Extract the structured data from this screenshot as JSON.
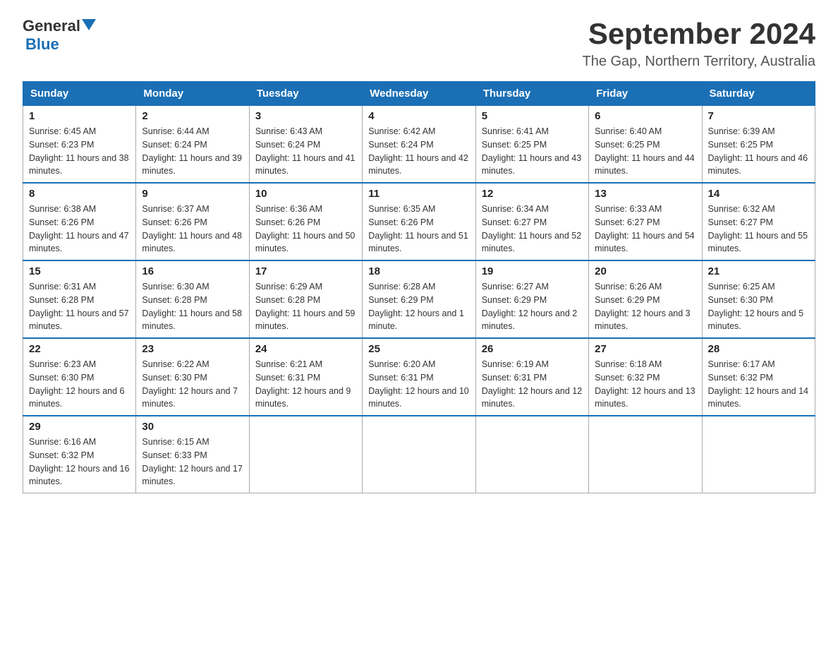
{
  "header": {
    "logo_text_general": "General",
    "logo_text_blue": "Blue",
    "month_year": "September 2024",
    "location": "The Gap, Northern Territory, Australia"
  },
  "days_of_week": [
    "Sunday",
    "Monday",
    "Tuesday",
    "Wednesday",
    "Thursday",
    "Friday",
    "Saturday"
  ],
  "weeks": [
    [
      {
        "day": "1",
        "sunrise": "6:45 AM",
        "sunset": "6:23 PM",
        "daylight": "11 hours and 38 minutes."
      },
      {
        "day": "2",
        "sunrise": "6:44 AM",
        "sunset": "6:24 PM",
        "daylight": "11 hours and 39 minutes."
      },
      {
        "day": "3",
        "sunrise": "6:43 AM",
        "sunset": "6:24 PM",
        "daylight": "11 hours and 41 minutes."
      },
      {
        "day": "4",
        "sunrise": "6:42 AM",
        "sunset": "6:24 PM",
        "daylight": "11 hours and 42 minutes."
      },
      {
        "day": "5",
        "sunrise": "6:41 AM",
        "sunset": "6:25 PM",
        "daylight": "11 hours and 43 minutes."
      },
      {
        "day": "6",
        "sunrise": "6:40 AM",
        "sunset": "6:25 PM",
        "daylight": "11 hours and 44 minutes."
      },
      {
        "day": "7",
        "sunrise": "6:39 AM",
        "sunset": "6:25 PM",
        "daylight": "11 hours and 46 minutes."
      }
    ],
    [
      {
        "day": "8",
        "sunrise": "6:38 AM",
        "sunset": "6:26 PM",
        "daylight": "11 hours and 47 minutes."
      },
      {
        "day": "9",
        "sunrise": "6:37 AM",
        "sunset": "6:26 PM",
        "daylight": "11 hours and 48 minutes."
      },
      {
        "day": "10",
        "sunrise": "6:36 AM",
        "sunset": "6:26 PM",
        "daylight": "11 hours and 50 minutes."
      },
      {
        "day": "11",
        "sunrise": "6:35 AM",
        "sunset": "6:26 PM",
        "daylight": "11 hours and 51 minutes."
      },
      {
        "day": "12",
        "sunrise": "6:34 AM",
        "sunset": "6:27 PM",
        "daylight": "11 hours and 52 minutes."
      },
      {
        "day": "13",
        "sunrise": "6:33 AM",
        "sunset": "6:27 PM",
        "daylight": "11 hours and 54 minutes."
      },
      {
        "day": "14",
        "sunrise": "6:32 AM",
        "sunset": "6:27 PM",
        "daylight": "11 hours and 55 minutes."
      }
    ],
    [
      {
        "day": "15",
        "sunrise": "6:31 AM",
        "sunset": "6:28 PM",
        "daylight": "11 hours and 57 minutes."
      },
      {
        "day": "16",
        "sunrise": "6:30 AM",
        "sunset": "6:28 PM",
        "daylight": "11 hours and 58 minutes."
      },
      {
        "day": "17",
        "sunrise": "6:29 AM",
        "sunset": "6:28 PM",
        "daylight": "11 hours and 59 minutes."
      },
      {
        "day": "18",
        "sunrise": "6:28 AM",
        "sunset": "6:29 PM",
        "daylight": "12 hours and 1 minute."
      },
      {
        "day": "19",
        "sunrise": "6:27 AM",
        "sunset": "6:29 PM",
        "daylight": "12 hours and 2 minutes."
      },
      {
        "day": "20",
        "sunrise": "6:26 AM",
        "sunset": "6:29 PM",
        "daylight": "12 hours and 3 minutes."
      },
      {
        "day": "21",
        "sunrise": "6:25 AM",
        "sunset": "6:30 PM",
        "daylight": "12 hours and 5 minutes."
      }
    ],
    [
      {
        "day": "22",
        "sunrise": "6:23 AM",
        "sunset": "6:30 PM",
        "daylight": "12 hours and 6 minutes."
      },
      {
        "day": "23",
        "sunrise": "6:22 AM",
        "sunset": "6:30 PM",
        "daylight": "12 hours and 7 minutes."
      },
      {
        "day": "24",
        "sunrise": "6:21 AM",
        "sunset": "6:31 PM",
        "daylight": "12 hours and 9 minutes."
      },
      {
        "day": "25",
        "sunrise": "6:20 AM",
        "sunset": "6:31 PM",
        "daylight": "12 hours and 10 minutes."
      },
      {
        "day": "26",
        "sunrise": "6:19 AM",
        "sunset": "6:31 PM",
        "daylight": "12 hours and 12 minutes."
      },
      {
        "day": "27",
        "sunrise": "6:18 AM",
        "sunset": "6:32 PM",
        "daylight": "12 hours and 13 minutes."
      },
      {
        "day": "28",
        "sunrise": "6:17 AM",
        "sunset": "6:32 PM",
        "daylight": "12 hours and 14 minutes."
      }
    ],
    [
      {
        "day": "29",
        "sunrise": "6:16 AM",
        "sunset": "6:32 PM",
        "daylight": "12 hours and 16 minutes."
      },
      {
        "day": "30",
        "sunrise": "6:15 AM",
        "sunset": "6:33 PM",
        "daylight": "12 hours and 17 minutes."
      },
      null,
      null,
      null,
      null,
      null
    ]
  ]
}
